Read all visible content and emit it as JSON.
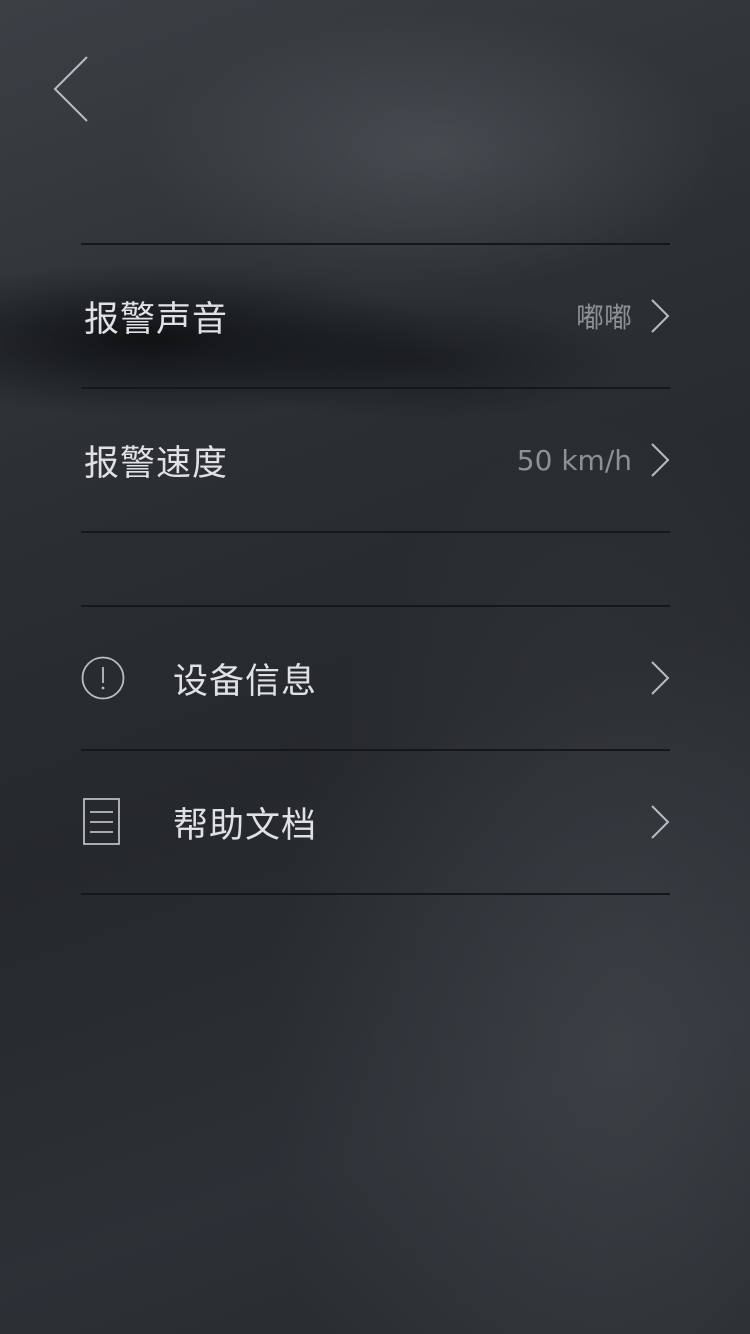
{
  "nav": {
    "back_icon": "chevron-left-icon"
  },
  "alarm_settings": {
    "items": [
      {
        "label": "报警声音",
        "value": "嘟嘟",
        "icon": "chevron-right-icon"
      },
      {
        "label": "报警速度",
        "value": "50 km/h",
        "icon": "chevron-right-icon"
      }
    ]
  },
  "info_settings": {
    "items": [
      {
        "label": "设备信息",
        "leading_icon": "info-circle-icon",
        "icon": "chevron-right-icon"
      },
      {
        "label": "帮助文档",
        "leading_icon": "document-icon",
        "icon": "chevron-right-icon"
      }
    ]
  },
  "colors": {
    "text_primary": "#dfe1e4",
    "text_secondary": "#8d9196",
    "divider": "#15171a",
    "icon_stroke": "#b9bdc2"
  }
}
